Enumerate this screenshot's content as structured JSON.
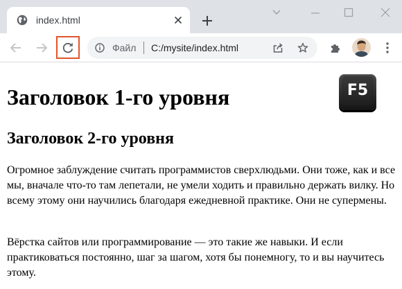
{
  "tab": {
    "title": "index.html"
  },
  "address_bar": {
    "scheme_label": "Файл",
    "url": "C:/mysite/index.html"
  },
  "page": {
    "h1": "Заголовок 1-го уровня",
    "h2": "Заголовок 2-го уровня",
    "paragraphs": [
      "Огромное заблуждение считать программистов сверхлюдьми. Они тоже, как и все мы, вначале что-то там лепетали, не умели ходить и правильно держать вилку. Но всему этому они научились благодаря ежедневной практике. Они не супермены.",
      "Вёрстка сайтов или программирование — это такие же навыки. И если практиковаться постоянно, шаг за шагом, хотя бы понемногу, то и вы научитесь этому."
    ]
  },
  "key_hint": {
    "label": "F5"
  },
  "colors": {
    "highlight": "#e0542c",
    "tabstrip": "#dee1e6",
    "omnibox": "#f1f3f4"
  },
  "icons": [
    "globe-icon",
    "close-icon",
    "plus-icon",
    "chevron-down-icon",
    "minimize-icon",
    "maximize-icon",
    "window-close-icon",
    "back-arrow-icon",
    "forward-arrow-icon",
    "reload-icon",
    "info-icon",
    "share-icon",
    "star-icon",
    "puzzle-icon",
    "avatar",
    "more-vert-icon"
  ]
}
